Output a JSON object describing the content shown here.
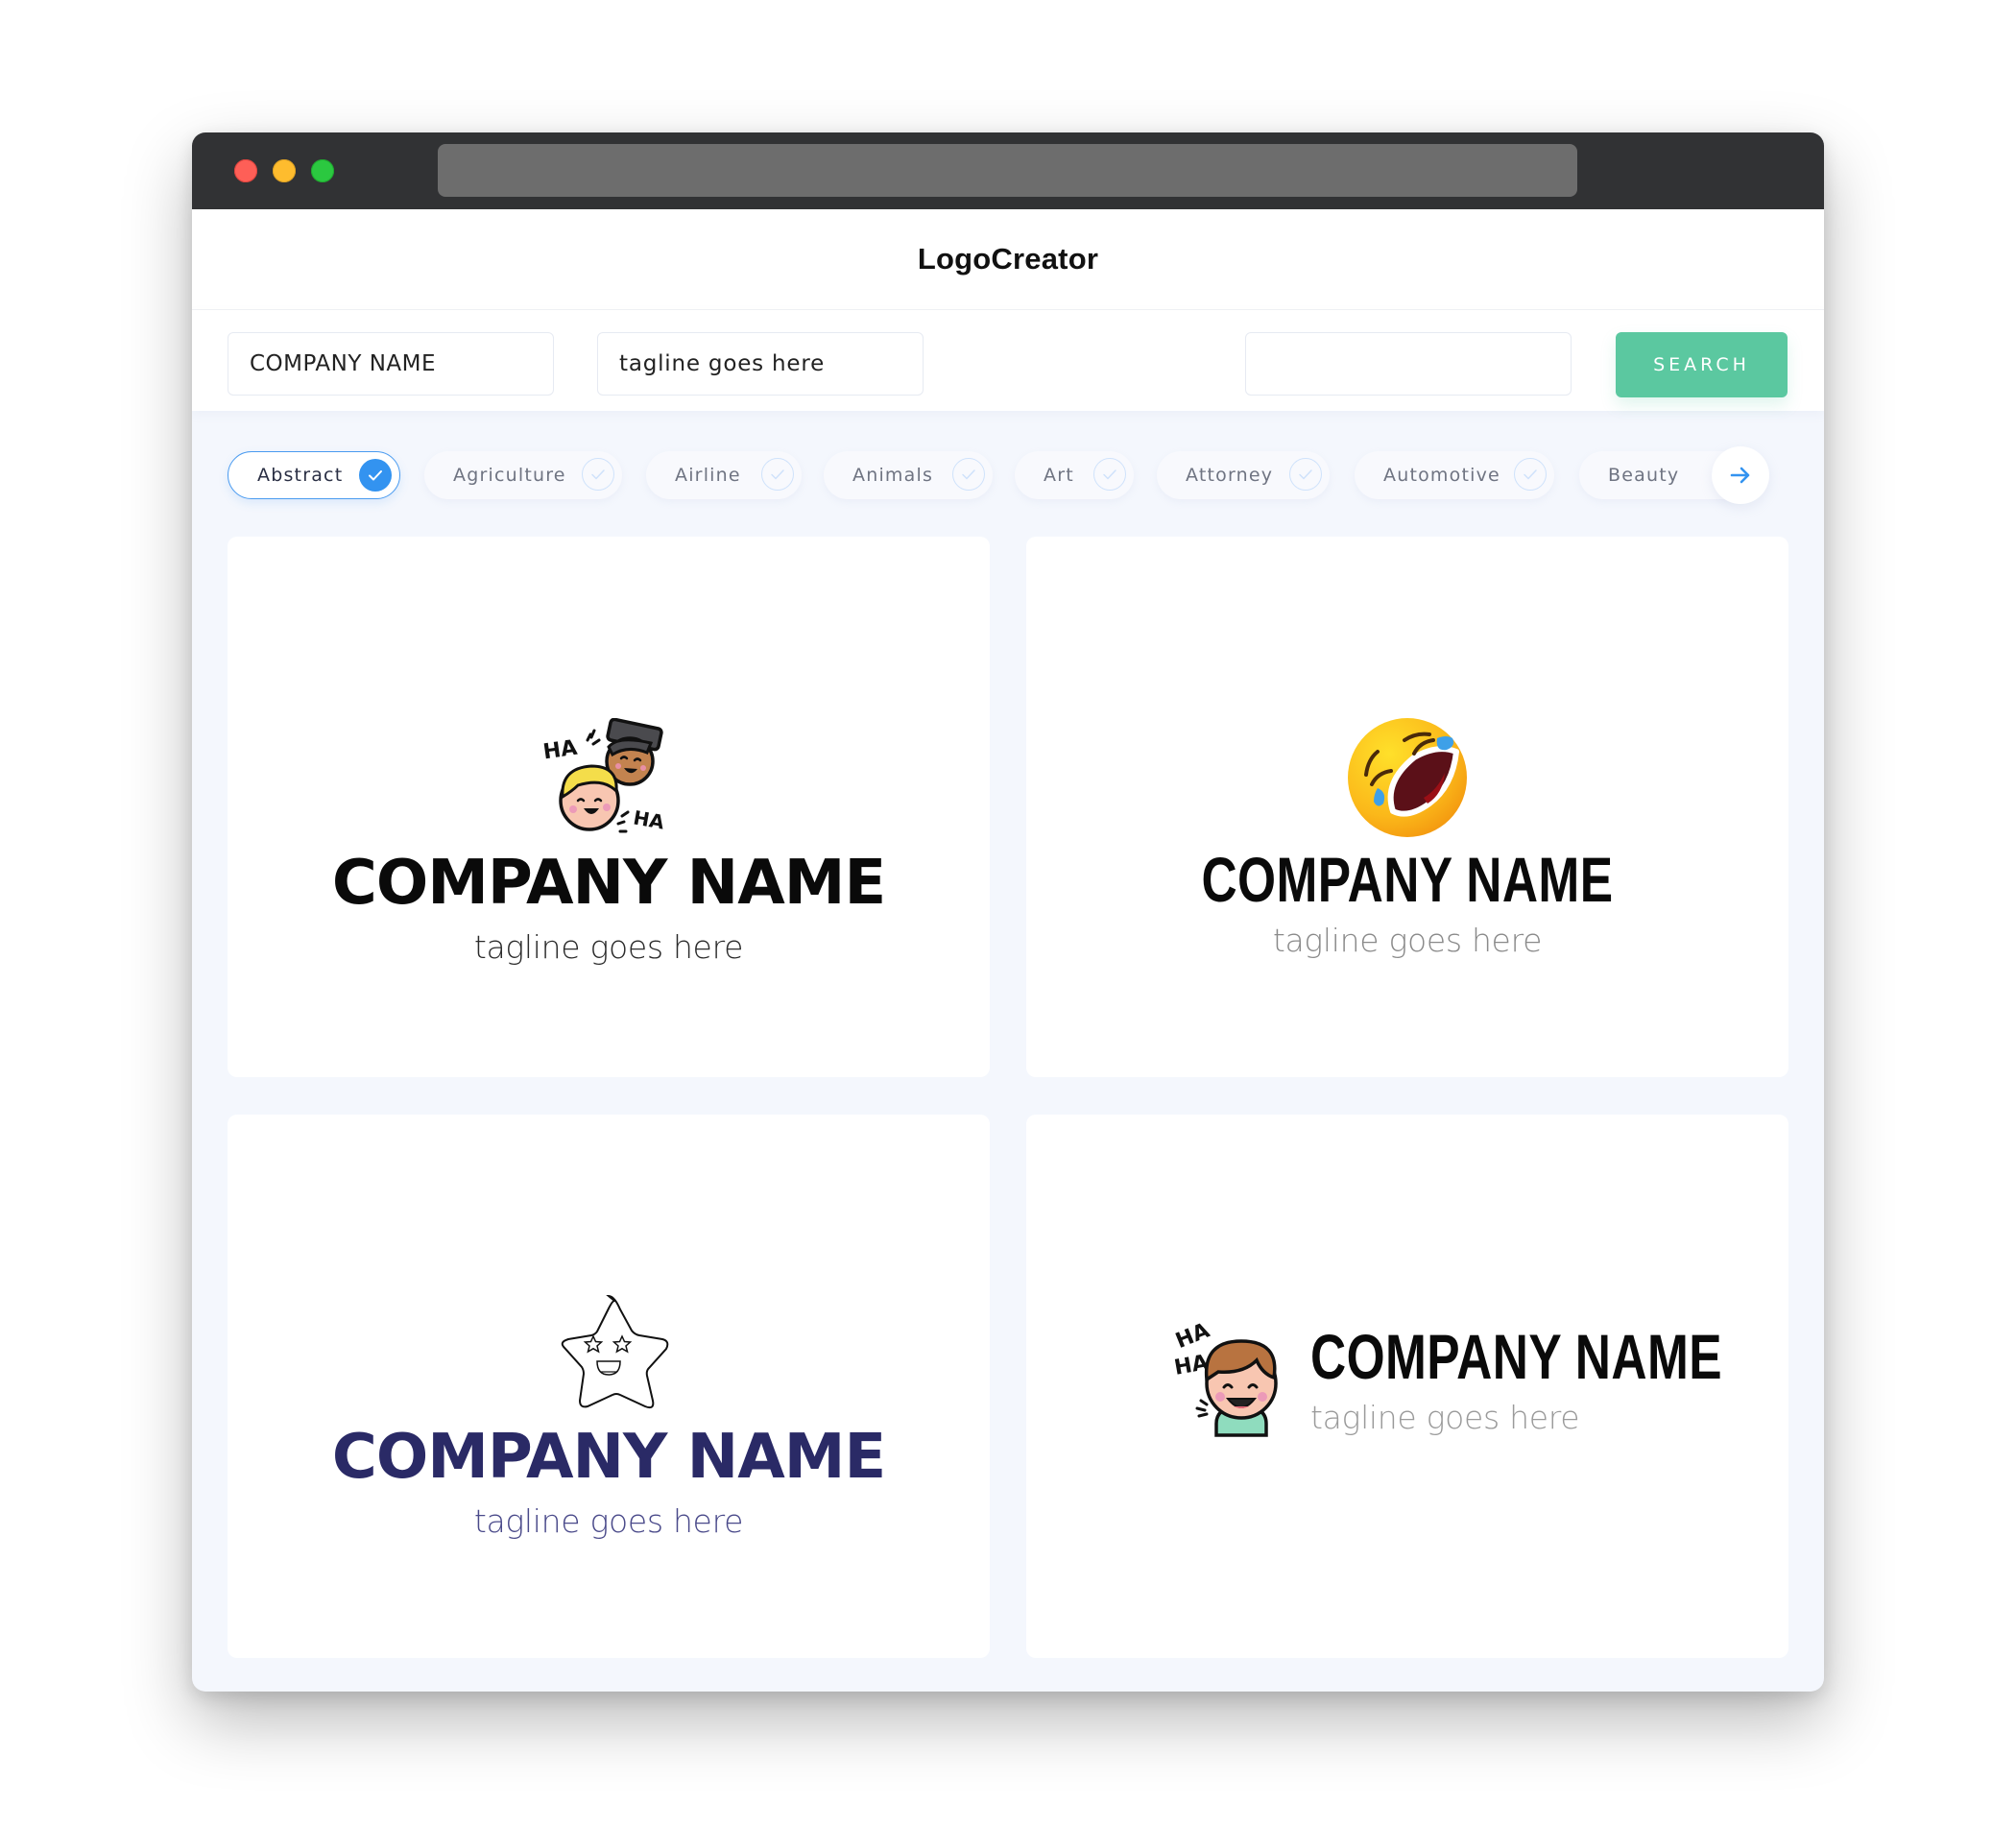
{
  "window": {
    "controls": [
      "close",
      "minimize",
      "maximize"
    ],
    "url": ""
  },
  "header": {
    "brand": "LogoCreator"
  },
  "form": {
    "company_name_value": "COMPANY NAME",
    "tagline_value": "tagline goes here",
    "search_value": "",
    "search_button_label": "SEARCH"
  },
  "filters": {
    "items": [
      {
        "label": "Abstract",
        "selected": true
      },
      {
        "label": "Agriculture",
        "selected": false
      },
      {
        "label": "Airline",
        "selected": false
      },
      {
        "label": "Animals",
        "selected": false
      },
      {
        "label": "Art",
        "selected": false
      },
      {
        "label": "Attorney",
        "selected": false
      },
      {
        "label": "Automotive",
        "selected": false
      },
      {
        "label": "Beauty",
        "selected": false
      }
    ],
    "next_icon": "arrow-right-icon"
  },
  "logos": [
    {
      "icon": "laughing-friends-icon",
      "name": "COMPANY NAME",
      "tagline": "tagline goes here",
      "name_color": "#0a0a0a",
      "tagline_color": "#2b2b2b",
      "icon_text": [
        "HA",
        "HA"
      ]
    },
    {
      "icon": "rolling-laughing-emoji-icon",
      "name": "COMPANY NAME",
      "tagline": "tagline goes here",
      "name_color": "#0a0a0a",
      "tagline_color": "#8a8a8a"
    },
    {
      "icon": "star-face-icon",
      "name": "COMPANY NAME",
      "tagline": "tagline goes here",
      "name_color": "#2a2a66",
      "tagline_color": "#4a4a8a"
    },
    {
      "icon": "laughing-boy-icon",
      "name": "COMPANY NAME",
      "tagline": "tagline goes here",
      "name_color": "#0a0a0a",
      "tagline_color": "#9a9a9a",
      "icon_text": [
        "HA",
        "HA"
      ]
    }
  ],
  "colors": {
    "accent_green": "#5bc8a0",
    "accent_blue": "#3393f0",
    "page_bg": "#f4f7fd",
    "titlebar": "#313234"
  }
}
